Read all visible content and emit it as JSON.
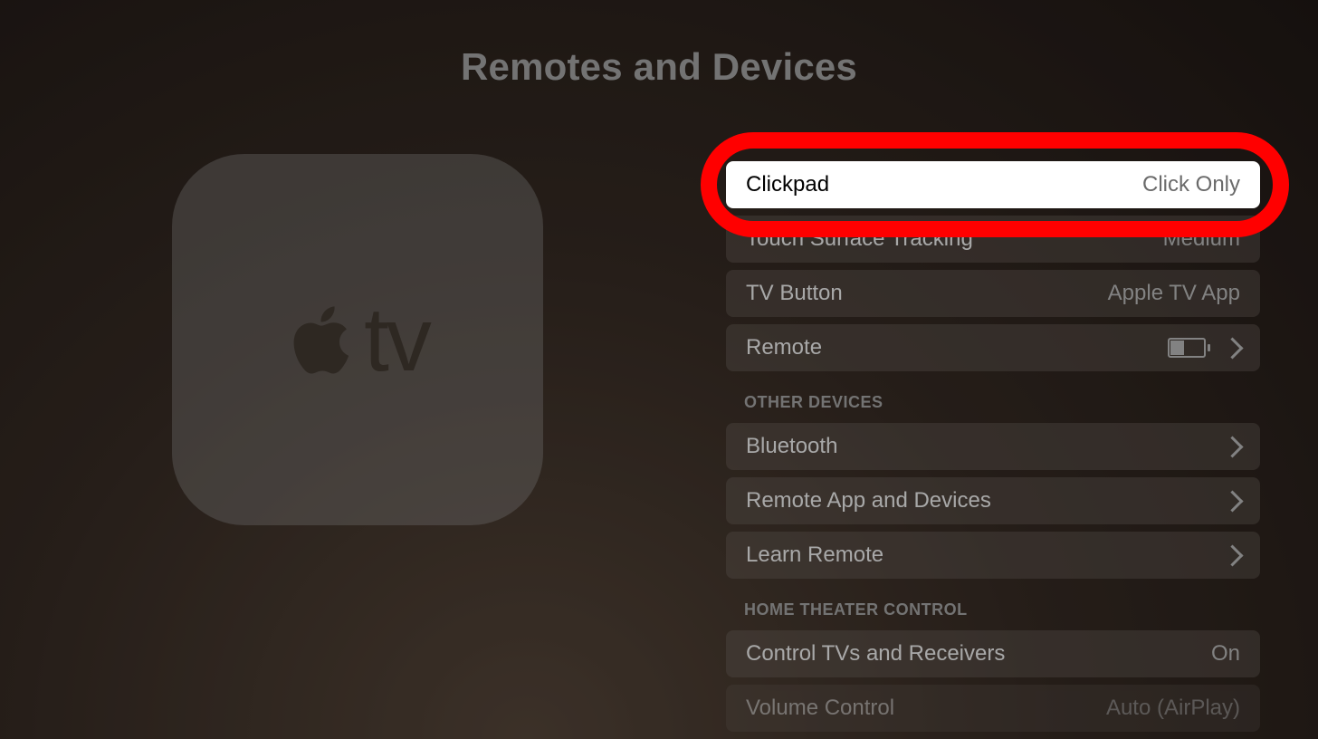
{
  "page": {
    "title": "Remotes and Devices"
  },
  "sidebar_tile": {
    "label": "tv"
  },
  "groups": [
    {
      "header": null,
      "rows": [
        {
          "label": "Clickpad",
          "value": "Click Only",
          "selected": true,
          "chevron": false,
          "battery": false
        },
        {
          "label": "Touch Surface Tracking",
          "value": "Medium",
          "selected": false,
          "chevron": false,
          "battery": false
        },
        {
          "label": "TV Button",
          "value": "Apple TV App",
          "selected": false,
          "chevron": false,
          "battery": false
        },
        {
          "label": "Remote",
          "value": "",
          "selected": false,
          "chevron": true,
          "battery": true
        }
      ]
    },
    {
      "header": "OTHER DEVICES",
      "rows": [
        {
          "label": "Bluetooth",
          "value": "",
          "selected": false,
          "chevron": true,
          "battery": false
        },
        {
          "label": "Remote App and Devices",
          "value": "",
          "selected": false,
          "chevron": true,
          "battery": false
        },
        {
          "label": "Learn Remote",
          "value": "",
          "selected": false,
          "chevron": true,
          "battery": false
        }
      ]
    },
    {
      "header": "HOME THEATER CONTROL",
      "rows": [
        {
          "label": "Control TVs and Receivers",
          "value": "On",
          "selected": false,
          "chevron": false,
          "battery": false
        },
        {
          "label": "Volume Control",
          "value": "Auto (AirPlay)",
          "selected": false,
          "chevron": false,
          "battery": false
        }
      ]
    }
  ]
}
